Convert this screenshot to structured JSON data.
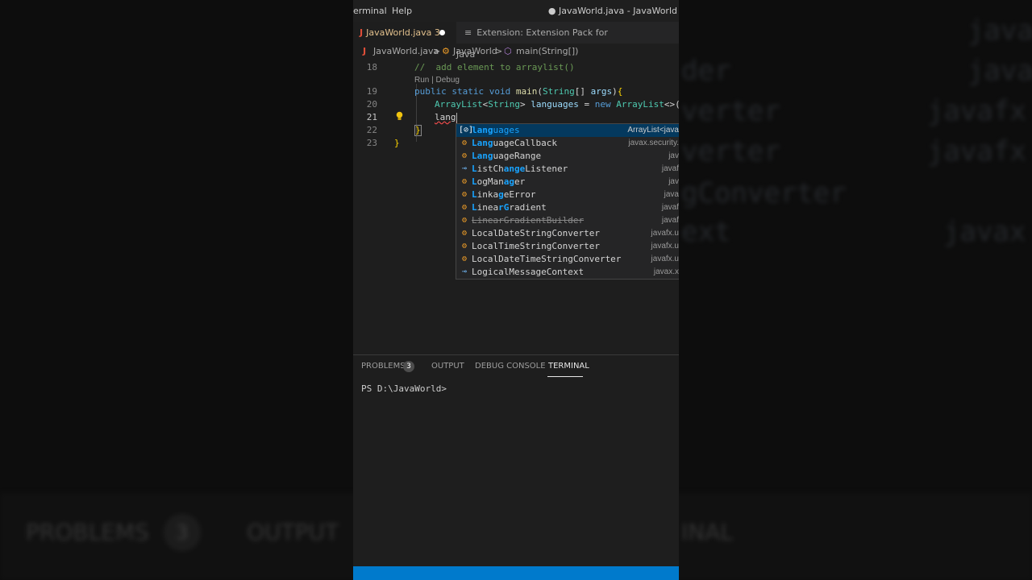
{
  "background": {
    "right_texts": [
      "javafx",
      "javafx",
      "der",
      "verter",
      "javafx.u",
      "verter",
      "javafx.u",
      "gConverter",
      "ext",
      "javax.x"
    ],
    "left_panel_labels": [
      "PROBLEMS",
      "OUTPUT",
      "INAL"
    ],
    "badge_count": "3"
  },
  "titlebar": {
    "menu_terminal": "erminal",
    "menu_help": "Help",
    "window_title": "● JavaWorld.java - JavaWorld"
  },
  "tabs": {
    "active_icon": "J",
    "active_label": "JavaWorld.java 3",
    "ext_icon": "≡",
    "ext_label": "Extension: Extension Pack for Java"
  },
  "breadcrumb": {
    "file_icon": "J",
    "file": "JavaWorld.java",
    "sep1": ">",
    "class_icon": "⚙",
    "class": "JavaWorld",
    "sep2": ">",
    "method_icon": "⬡",
    "method": "main(String[])"
  },
  "editor": {
    "line_numbers": [
      "18",
      "19",
      "20",
      "21",
      "22",
      "23"
    ],
    "comment": "//  add element to arraylist()",
    "codelens": "Run | Debug",
    "line19": {
      "kw": "public static void ",
      "fn": "main",
      "p1": "(",
      "ty": "String",
      "p2": "[] ",
      "vr": "args",
      "p3": ")",
      "brace": "{"
    },
    "line20": {
      "ty1": "ArrayList",
      "lt": "<",
      "ty2": "String",
      "gt": "> ",
      "vr": "languages",
      "eq": " = ",
      "kw": "new ",
      "ty3": "ArrayList",
      "rest": "<>()"
    },
    "typed": "lang",
    "close_inner": "}",
    "close_outer": "}"
  },
  "suggestions": [
    {
      "icon": "[⊘]",
      "match": "lang",
      "rest": "uages",
      "detail": "ArrayList<java",
      "kind": "var"
    },
    {
      "icon": "⚙",
      "pre": "",
      "match": "Lang",
      "rest": "uageCallback",
      "detail": "javax.security.",
      "kind": "class"
    },
    {
      "icon": "⚙",
      "match": "Lang",
      "rest": "uageRange",
      "detail": "jav",
      "kind": "class"
    },
    {
      "icon": "⊸",
      "match": "L",
      "mid": "istCh",
      "match2": "ange",
      "rest": "Listener",
      "detail": "javaf",
      "kind": "iface"
    },
    {
      "icon": "⚙",
      "match": "L",
      "mid": "ogMan",
      "match2": "ag",
      "rest": "er",
      "detail": "jav",
      "kind": "class"
    },
    {
      "icon": "⚙",
      "match": "L",
      "mid": "inka",
      "match2": "g",
      "rest": "eError",
      "detail": "java",
      "kind": "class"
    },
    {
      "icon": "⚙",
      "match": "L",
      "mid": "inea",
      "match2": "rG",
      "rest": "radient",
      "detail": "javaf",
      "kind": "class"
    },
    {
      "icon": "⚙",
      "label": "LinearGradientBuilder",
      "detail": "javaf",
      "kind": "class",
      "deprecated": true
    },
    {
      "icon": "⚙",
      "label": "LocalDateStringConverter",
      "detail": "javafx.u",
      "kind": "class"
    },
    {
      "icon": "⚙",
      "label": "LocalTimeStringConverter",
      "detail": "javafx.u",
      "kind": "class"
    },
    {
      "icon": "⚙",
      "label": "LocalDateTimeStringConverter",
      "detail": "javafx.u",
      "kind": "class"
    },
    {
      "icon": "⊸",
      "label": "LogicalMessageContext",
      "detail": "javax.x",
      "kind": "iface"
    }
  ],
  "panel": {
    "tab_problems": "PROBLEMS",
    "problems_count": "3",
    "tab_output": "OUTPUT",
    "tab_debug": "DEBUG CONSOLE",
    "tab_terminal": "TERMINAL",
    "prompt": "PS D:\\JavaWorld>"
  },
  "colors": {
    "statusbar": "#007acc",
    "editor_bg": "#1e1e1e",
    "suggest_highlight": "#18a3ff"
  }
}
